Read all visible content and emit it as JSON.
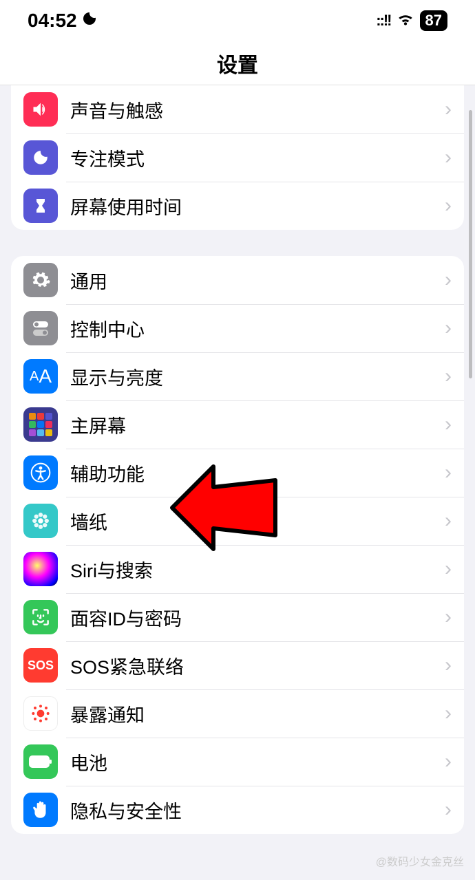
{
  "status": {
    "time": "04:52",
    "moon_icon": "moon-icon",
    "battery": "87"
  },
  "header": {
    "title": "设置"
  },
  "group1": {
    "items": [
      {
        "label": "声音与触感",
        "icon": "sound-icon"
      },
      {
        "label": "专注模式",
        "icon": "moon-icon"
      },
      {
        "label": "屏幕使用时间",
        "icon": "hourglass-icon"
      }
    ]
  },
  "group2": {
    "items": [
      {
        "label": "通用",
        "icon": "gear-icon"
      },
      {
        "label": "控制中心",
        "icon": "switches-icon"
      },
      {
        "label": "显示与亮度",
        "icon": "aa-icon"
      },
      {
        "label": "主屏幕",
        "icon": "home-grid-icon"
      },
      {
        "label": "辅助功能",
        "icon": "accessibility-icon"
      },
      {
        "label": "墙纸",
        "icon": "flower-icon"
      },
      {
        "label": "Siri与搜索",
        "icon": "siri-icon"
      },
      {
        "label": "面容ID与密码",
        "icon": "faceid-icon"
      },
      {
        "label": "SOS紧急联络",
        "icon": "sos-icon"
      },
      {
        "label": "暴露通知",
        "icon": "exposure-icon"
      },
      {
        "label": "电池",
        "icon": "battery-icon"
      },
      {
        "label": "隐私与安全性",
        "icon": "hand-icon"
      }
    ]
  },
  "watermark": "@数码少女金克丝"
}
